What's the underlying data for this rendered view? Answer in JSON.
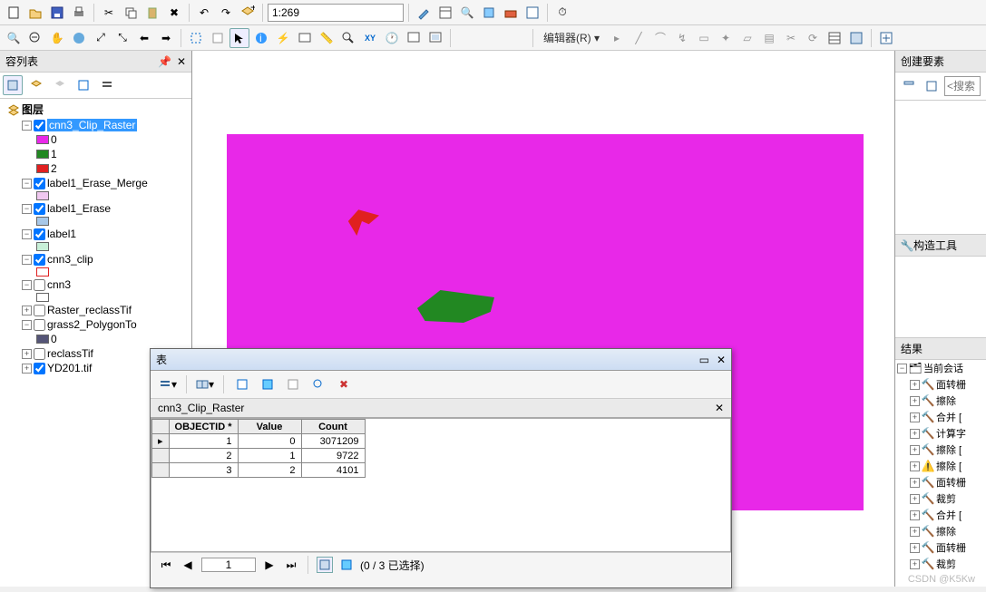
{
  "scale": "1:269",
  "editor_label": "编辑器(R)",
  "toc": {
    "title": "容列表",
    "root": "图层",
    "layers": [
      {
        "name": "cnn3_Clip_Raster",
        "checked": true,
        "selected": true,
        "expanded": true,
        "classes": [
          {
            "label": "0",
            "color": "#e828e8"
          },
          {
            "label": "1",
            "color": "#228822"
          },
          {
            "label": "2",
            "color": "#e02020"
          }
        ]
      },
      {
        "name": "label1_Erase_Merge",
        "checked": true,
        "expanded": true,
        "classes": [
          {
            "label": "",
            "color": "#f0c8f0"
          }
        ]
      },
      {
        "name": "label1_Erase",
        "checked": true,
        "expanded": true,
        "classes": [
          {
            "label": "",
            "color": "#a8c8e8"
          }
        ]
      },
      {
        "name": "label1",
        "checked": true,
        "expanded": true,
        "classes": [
          {
            "label": "",
            "color": "#c8f0d8"
          }
        ]
      },
      {
        "name": "cnn3_clip",
        "checked": true,
        "expanded": true,
        "classes": [
          {
            "label": "",
            "color": "#ffffff",
            "outline": "#e02020"
          }
        ]
      },
      {
        "name": "cnn3",
        "checked": false,
        "expanded": true,
        "classes": [
          {
            "label": "",
            "color": "#ffffff",
            "outline": "#666"
          }
        ]
      },
      {
        "name": "Raster_reclassTif",
        "checked": false,
        "expanded": false
      },
      {
        "name": "grass2_PolygonTo",
        "checked": false,
        "expanded": true,
        "classes": [
          {
            "label": "0",
            "color": "#555577"
          }
        ]
      },
      {
        "name": "reclassTif",
        "checked": false,
        "expanded": false
      },
      {
        "name": "YD201.tif",
        "checked": true,
        "expanded": false
      }
    ]
  },
  "table": {
    "window_title": "表",
    "tab": "cnn3_Clip_Raster",
    "columns": [
      "OBJECTID *",
      "Value",
      "Count"
    ],
    "rows": [
      {
        "OBJECTID": 1,
        "Value": 0,
        "Count": 3071209
      },
      {
        "OBJECTID": 2,
        "Value": 1,
        "Count": 9722
      },
      {
        "OBJECTID": 3,
        "Value": 2,
        "Count": 4101
      }
    ],
    "nav": {
      "record": "1",
      "status": "(0 / 3 已选择)"
    }
  },
  "create": {
    "title": "创建要素",
    "search_placeholder": "<搜索"
  },
  "construct": {
    "title": "构造工具"
  },
  "results": {
    "title": "结果",
    "session": "当前会话",
    "items": [
      {
        "icon": "hammer",
        "label": "面转栅"
      },
      {
        "icon": "hammer",
        "label": "擦除"
      },
      {
        "icon": "hammer",
        "label": "合并 ["
      },
      {
        "icon": "hammer",
        "label": "计算字"
      },
      {
        "icon": "hammer",
        "label": "擦除 ["
      },
      {
        "icon": "warn",
        "label": "擦除 ["
      },
      {
        "icon": "hammer",
        "label": "面转栅"
      },
      {
        "icon": "hammer",
        "label": "裁剪"
      },
      {
        "icon": "hammer",
        "label": "合并 ["
      },
      {
        "icon": "hammer",
        "label": "擦除"
      },
      {
        "icon": "hammer",
        "label": "面转栅"
      },
      {
        "icon": "hammer",
        "label": "裁剪"
      }
    ]
  },
  "watermark": "CSDN @K5Kw"
}
